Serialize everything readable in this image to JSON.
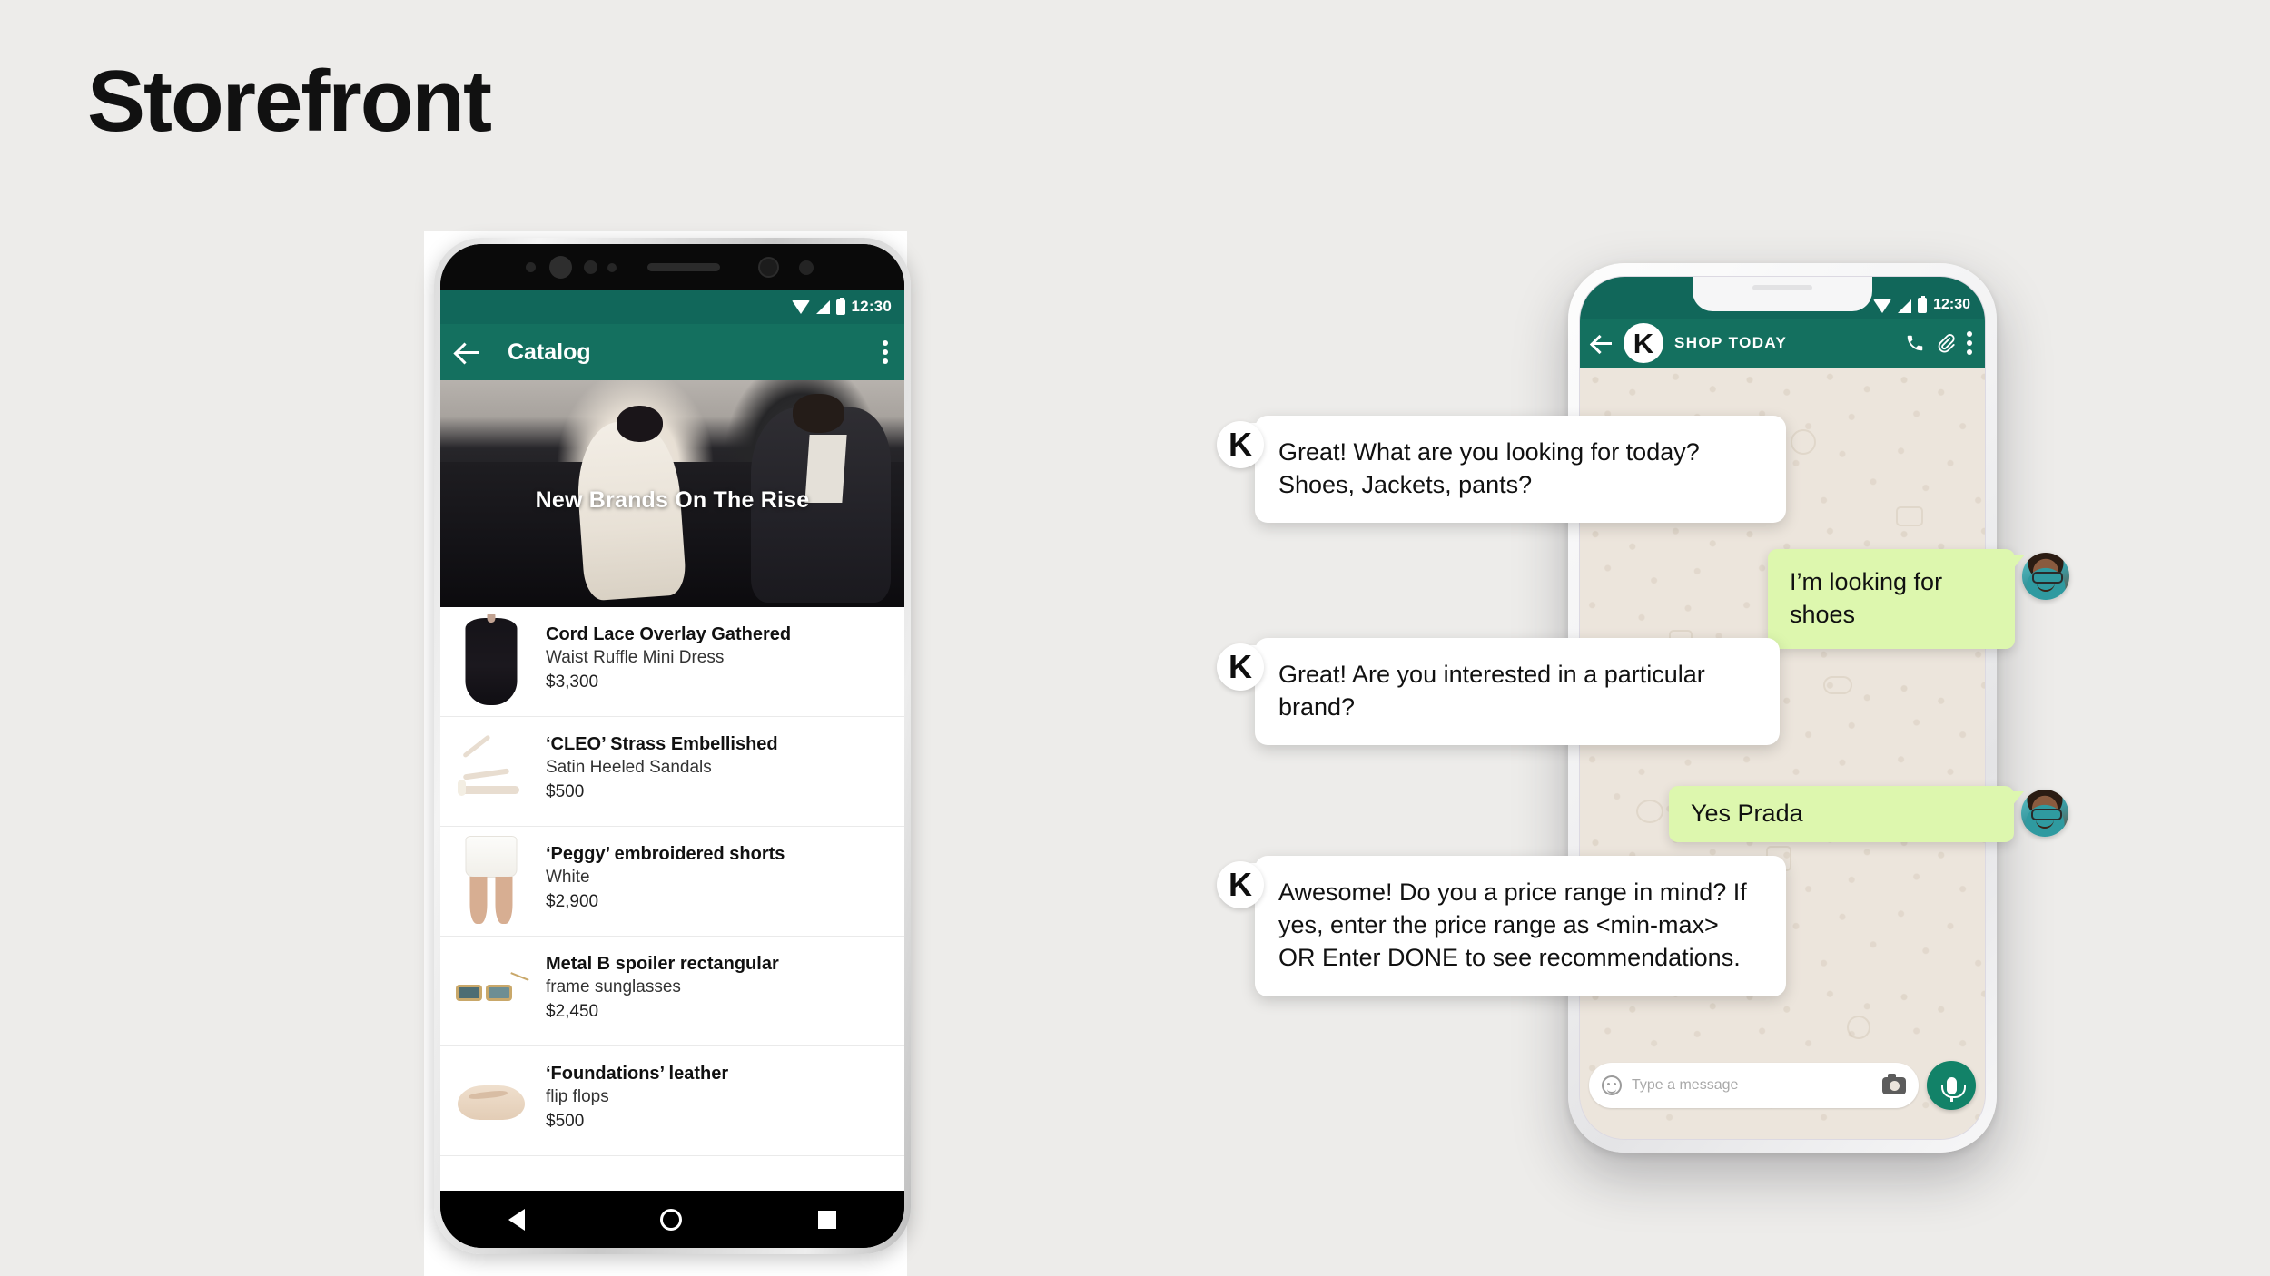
{
  "page": {
    "title": "Storefront",
    "background_color": "#edecea"
  },
  "colors": {
    "teal_statusbar": "#11675a",
    "teal_appbar": "#14705f",
    "bubble_out": "#ddf7ae",
    "bubble_in": "#ffffff",
    "mic_green": "#128268",
    "chat_wallpaper": "#ece5dc"
  },
  "left_phone": {
    "status_bar": {
      "time": "12:30",
      "icons": [
        "wifi-icon",
        "signal-icon",
        "battery-icon"
      ]
    },
    "app_bar": {
      "back_label": "back-arrow-icon",
      "title": "Catalog",
      "menu_label": "overflow-menu-icon"
    },
    "hero": {
      "title": "New Brands On The Rise"
    },
    "products": [
      {
        "name": "Cord Lace Overlay Gathered",
        "sub": "Waist Ruffle Mini Dress",
        "price": "$3,300",
        "art": "dress"
      },
      {
        "name": "‘CLEO’  Strass Embellished",
        "sub": "Satin Heeled Sandals",
        "price": "$500",
        "art": "sandal"
      },
      {
        "name": "‘Peggy’ embroidered shorts",
        "sub": "White",
        "price": "$2,900",
        "art": "shorts"
      },
      {
        "name": "Metal B spoiler rectangular",
        "sub": "frame sunglasses",
        "price": "$2,450",
        "art": "sunglasses"
      },
      {
        "name": "‘Foundations’ leather",
        "sub": "flip flops",
        "price": "$500",
        "art": "flipflop"
      }
    ],
    "nav_bar": {
      "back": "nav-back-icon",
      "home": "nav-home-icon",
      "recents": "nav-recents-icon"
    }
  },
  "right_phone": {
    "status_bar": {
      "time": "12:30",
      "icons": [
        "wifi-icon",
        "signal-icon",
        "battery-icon"
      ]
    },
    "app_bar": {
      "avatar_letter": "K",
      "title": "SHOP TODAY",
      "call_label": "phone-icon",
      "attach_label": "paperclip-icon",
      "menu_label": "overflow-menu-icon"
    },
    "messages": [
      {
        "from": "bot",
        "avatar_letter": "K",
        "text": "Great! What are you looking for today? Shoes, Jackets, pants?"
      },
      {
        "from": "me",
        "text": "I’m looking for shoes"
      },
      {
        "from": "bot",
        "avatar_letter": "K",
        "text": "Great! Are you interested in a particular brand?"
      },
      {
        "from": "me",
        "text": "Yes Prada"
      },
      {
        "from": "bot",
        "avatar_letter": "K",
        "text": "Awesome! Do you a price range in mind? If yes, enter the price range as <min-max>\nOR Enter DONE to see recommendations."
      }
    ],
    "input_bar": {
      "placeholder": "Type a message",
      "emoji_label": "emoji-icon",
      "camera_label": "camera-icon",
      "mic_label": "microphone-icon"
    }
  }
}
